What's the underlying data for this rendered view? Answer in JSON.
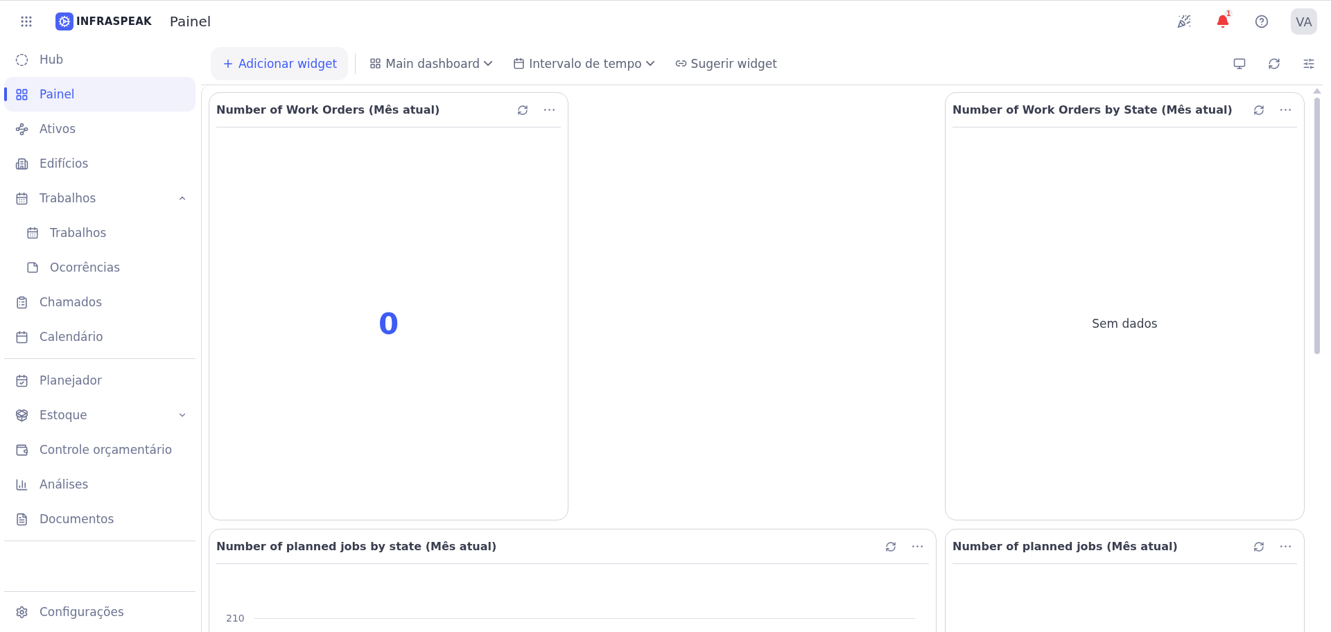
{
  "header": {
    "brand": "INFRASPEAK",
    "page_title": "Painel",
    "notifications": {
      "count": "1"
    },
    "avatar": "VA"
  },
  "sidebar": {
    "sections": [
      {
        "items": [
          {
            "label": "Hub",
            "selected": false
          },
          {
            "label": "Painel",
            "selected": true
          },
          {
            "label": "Ativos",
            "selected": false
          },
          {
            "label": "Edifícios",
            "selected": false
          },
          {
            "label": "Trabalhos",
            "selected": false,
            "expanded": true,
            "children": [
              {
                "label": "Trabalhos",
                "selected": false
              },
              {
                "label": "Ocorrências",
                "selected": false
              }
            ]
          },
          {
            "label": "Chamados",
            "selected": false
          },
          {
            "label": "Calendário",
            "selected": false
          }
        ]
      },
      {
        "items": [
          {
            "label": "Planejador",
            "selected": false
          },
          {
            "label": "Estoque",
            "selected": false,
            "expanded": false
          },
          {
            "label": "Controle orçamentário",
            "selected": false
          },
          {
            "label": "Análises",
            "selected": false
          },
          {
            "label": "Documentos",
            "selected": false
          }
        ]
      }
    ],
    "footer": {
      "label": "Configurações"
    }
  },
  "toolbar": {
    "add_button": "Adicionar widget",
    "dashboard_menu": "Main dashboard",
    "time_range_menu": "Intervalo de tempo",
    "suggest_button": "Sugerir widget"
  },
  "widgets": [
    {
      "kind": "number",
      "title": "Number of Work Orders (Mês atual)",
      "value": "0"
    },
    {
      "kind": "empty",
      "title": "Number of Work Orders by State (Mês atual)",
      "message": "Sem dados"
    },
    {
      "kind": "chart",
      "title": "Number of planned jobs by state (Mês atual)",
      "axis_label": "210"
    },
    {
      "kind": "blank",
      "title": "Number of planned jobs (Mês atual)"
    }
  ]
}
